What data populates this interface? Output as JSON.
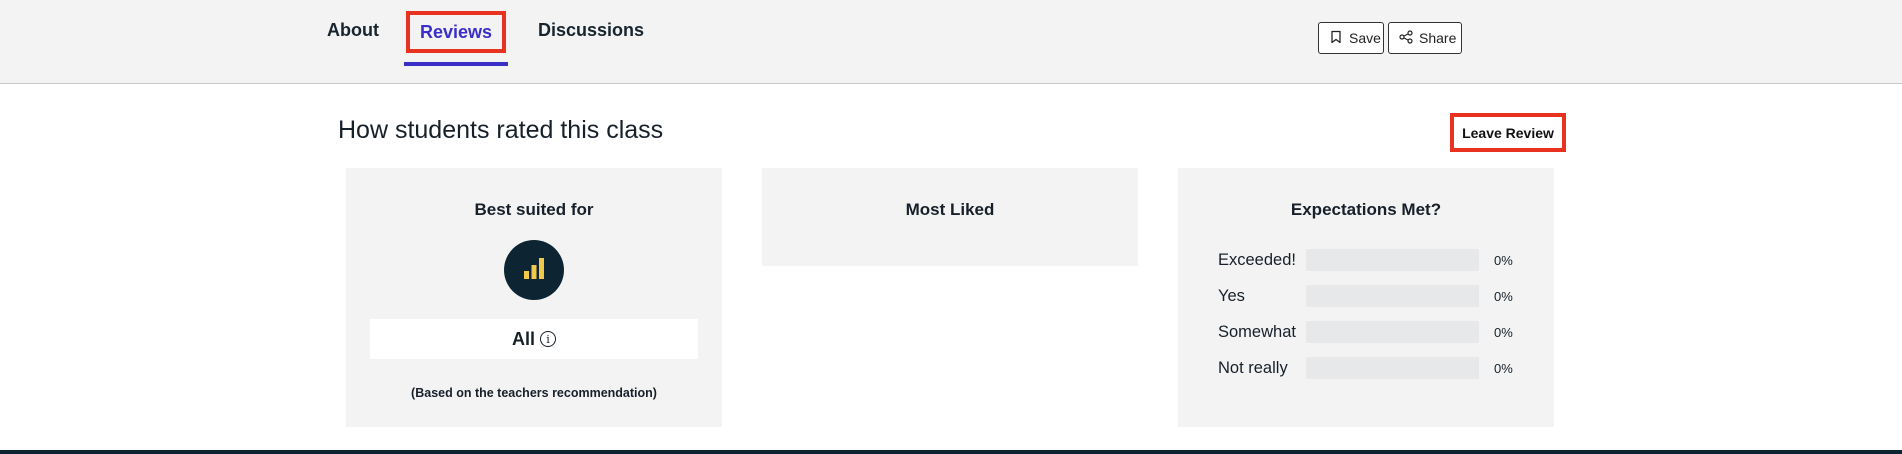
{
  "tabs": {
    "about": "About",
    "reviews": "Reviews",
    "discussions": "Discussions"
  },
  "toolbar": {
    "save_label": "Save",
    "save_icon": "bookmark-icon",
    "share_label": "Share",
    "share_icon": "share-icon"
  },
  "main": {
    "title": "How students rated this class",
    "leave_review_label": "Leave Review"
  },
  "best_suited": {
    "title": "Best suited for",
    "icon": "signal-bars-icon",
    "level": "All",
    "note": "(Based on the teachers recommendation)"
  },
  "most_liked": {
    "title": "Most Liked"
  },
  "expectations": {
    "title": "Expectations Met?",
    "rows": [
      {
        "label": "Exceeded!",
        "pct_text": "0%",
        "value": 0
      },
      {
        "label": "Yes",
        "pct_text": "0%",
        "value": 0
      },
      {
        "label": "Somewhat",
        "pct_text": "0%",
        "value": 0
      },
      {
        "label": "Not really",
        "pct_text": "0%",
        "value": 0
      }
    ]
  },
  "colors": {
    "accent": "#3b2fc9",
    "highlight_border": "#e8321f",
    "icon_circle": "#0d2532",
    "icon_bars": "#f1c94a"
  }
}
